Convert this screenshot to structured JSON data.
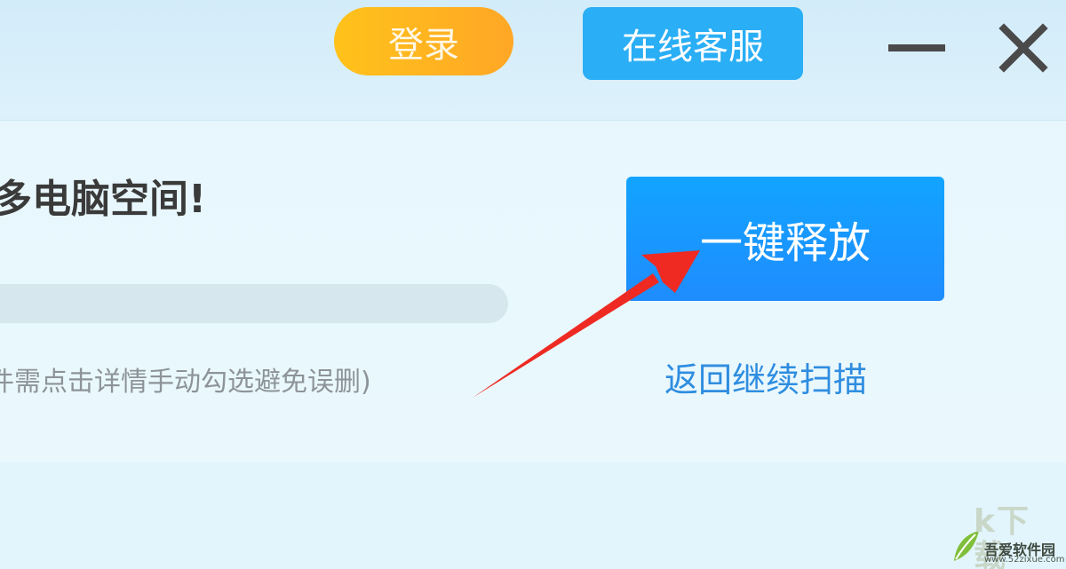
{
  "header": {
    "login_label": "登录",
    "service_label": "在线客服",
    "minimize_icon": "minimize-icon",
    "close_icon": "close-icon"
  },
  "main": {
    "headline": "多电脑空间!",
    "hint": "件需点击详情手动勾选避免误删)",
    "release_label": "一键释放",
    "rescan_label": "返回继续扫描"
  },
  "annotation": {
    "arrow_color": "#ee2a22"
  },
  "watermark": {
    "big_text": "k下载",
    "name": "吾爱软件园",
    "url": "www.52zixue.com"
  },
  "colors": {
    "login": "#ffb81f",
    "service": "#2aaef5",
    "release": "#1899ff",
    "link": "#2f8de0"
  }
}
